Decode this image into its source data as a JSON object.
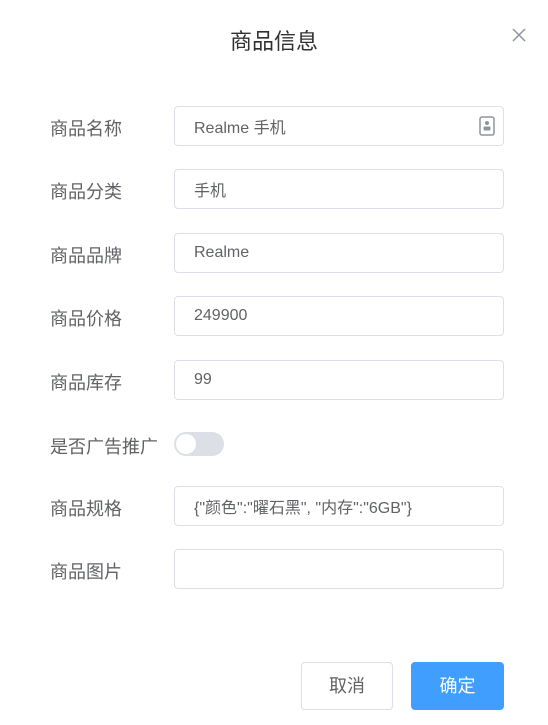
{
  "dialog": {
    "title": "商品信息",
    "close_icon": "close-icon"
  },
  "form": {
    "name": {
      "label": "商品名称",
      "value": "Realme 手机",
      "icon": "contact-card-icon"
    },
    "category": {
      "label": "商品分类",
      "value": "手机"
    },
    "brand": {
      "label": "商品品牌",
      "value": "Realme"
    },
    "price": {
      "label": "商品价格",
      "value": "249900"
    },
    "stock": {
      "label": "商品库存",
      "value": "99"
    },
    "ad_promotion": {
      "label": "是否广告推广",
      "enabled": false
    },
    "spec": {
      "label": "商品规格",
      "value": "{\"颜色\":\"曜石黑\", \"内存\":\"6GB\"}"
    },
    "image": {
      "label": "商品图片",
      "value": ""
    }
  },
  "footer": {
    "cancel_label": "取消",
    "confirm_label": "确定"
  },
  "colors": {
    "primary": "#409eff",
    "border": "#dcdfe6",
    "text": "#606266",
    "title": "#303133"
  }
}
